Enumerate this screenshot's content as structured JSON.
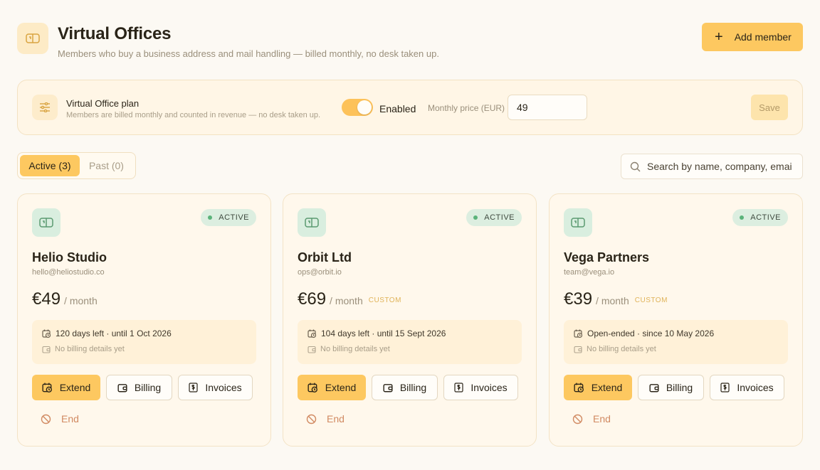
{
  "header": {
    "title": "Virtual Offices",
    "subtitle": "Members who buy a business address and mail handling — billed monthly, no desk taken up.",
    "add_button": "Add member",
    "icon": "mailbox-icon"
  },
  "plan": {
    "title": "Virtual Office plan",
    "subtitle": "Members are billed monthly and counted in revenue — no desk taken up.",
    "toggle_label": "Enabled",
    "toggle_on": true,
    "price_label": "Monthly price (EUR)",
    "price_value": "49",
    "save_label": "Save"
  },
  "tabs": [
    {
      "label": "Active (3)",
      "active": true
    },
    {
      "label": "Past (0)",
      "active": false
    }
  ],
  "search": {
    "placeholder": "Search by name, company, emai"
  },
  "members": [
    {
      "name": "Helio Studio",
      "email": "hello@heliostudio.co",
      "status": "ACTIVE",
      "price": "€49",
      "per": "/ month",
      "custom": "",
      "term": "120 days left · until 1 Oct 2026",
      "billing": "No billing details yet"
    },
    {
      "name": "Orbit Ltd",
      "email": "ops@orbit.io",
      "status": "ACTIVE",
      "price": "€69",
      "per": "/ month",
      "custom": "CUSTOM",
      "term": "104 days left · until 15 Sept 2026",
      "billing": "No billing details yet"
    },
    {
      "name": "Vega Partners",
      "email": "team@vega.io",
      "status": "ACTIVE",
      "price": "€39",
      "per": "/ month",
      "custom": "CUSTOM",
      "term": "Open-ended · since 10 May 2026",
      "billing": "No billing details yet"
    }
  ],
  "actions": {
    "extend": "Extend",
    "billing": "Billing",
    "invoices": "Invoices",
    "end": "End"
  },
  "colors": {
    "accent": "#fdc860",
    "background": "#fcf9f3",
    "card": "#fff8ec",
    "status_green": "#5bb37a",
    "danger": "#d18a62"
  }
}
